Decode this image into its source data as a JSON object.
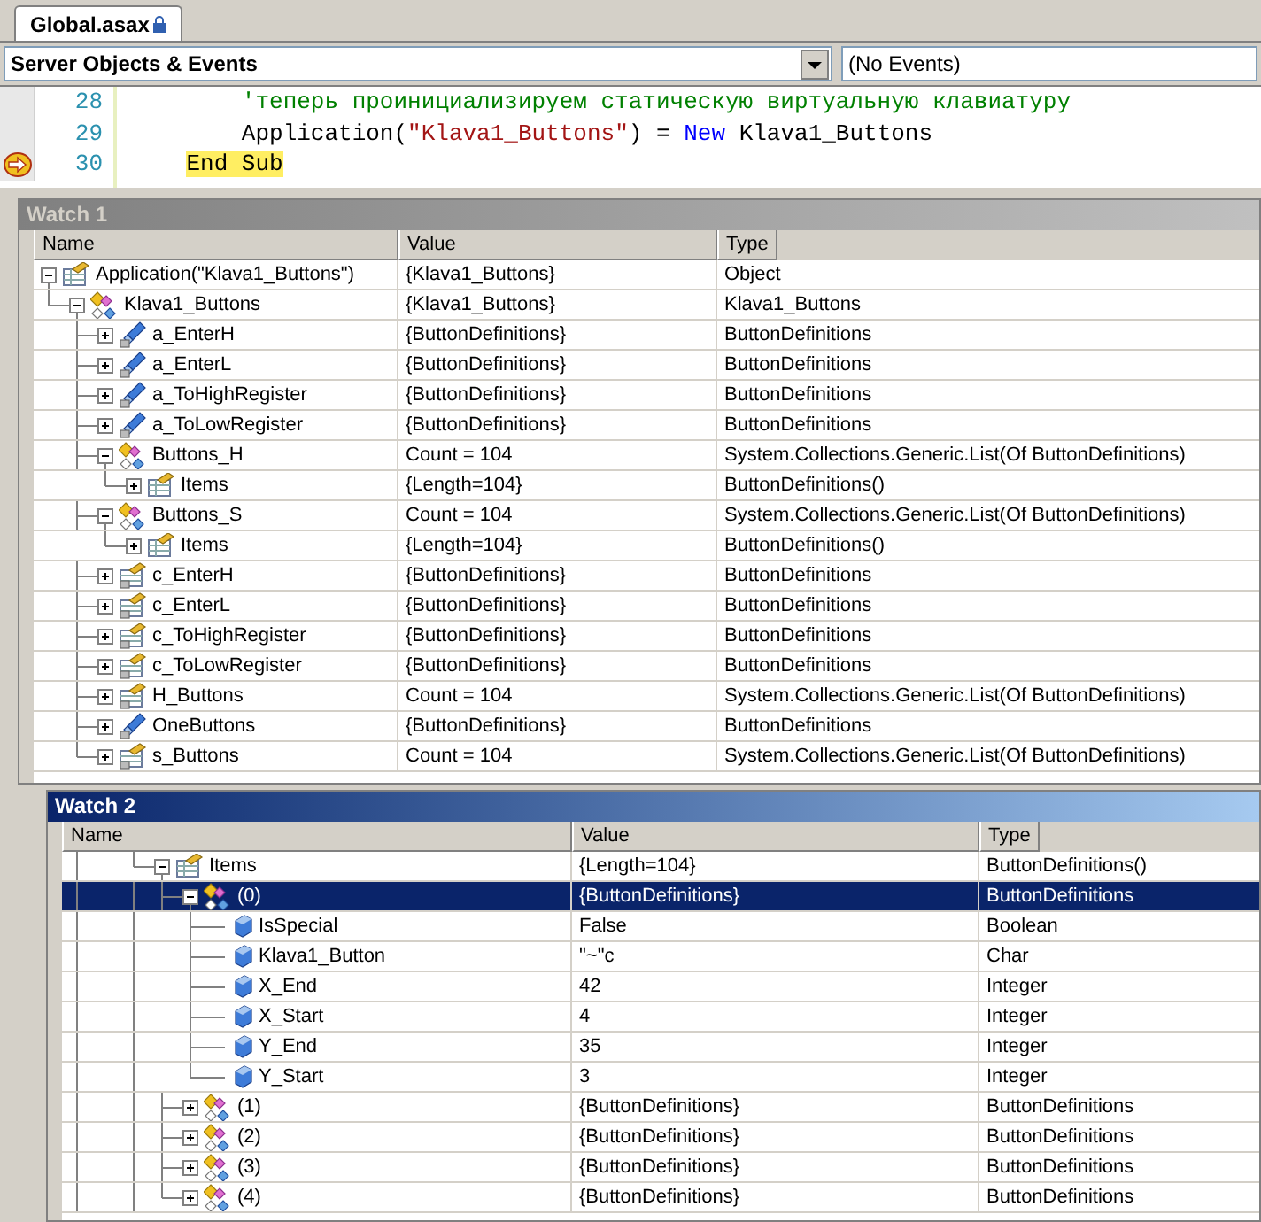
{
  "editor_tab": {
    "label": "Global.asax",
    "locked": true
  },
  "object_dropdown": {
    "value": "Server Objects & Events"
  },
  "event_dropdown": {
    "value": "(No Events)"
  },
  "code_lines": [
    {
      "number": "28",
      "current": false,
      "highlight": false,
      "parts": [
        {
          "kind": "comment",
          "text": "        'теперь проинициализируем статическую виртуальную клавиатуру"
        }
      ]
    },
    {
      "number": "29",
      "current": false,
      "highlight": false,
      "parts": [
        {
          "kind": "plain",
          "text": "        Application("
        },
        {
          "kind": "string",
          "text": "\"Klava1_Buttons\""
        },
        {
          "kind": "plain",
          "text": ") = "
        },
        {
          "kind": "keyword",
          "text": "New"
        },
        {
          "kind": "plain",
          "text": " Klava1_Buttons"
        }
      ]
    },
    {
      "number": "30",
      "current": true,
      "highlight": true,
      "parts": [
        {
          "kind": "plain",
          "text": "    End Sub"
        }
      ]
    }
  ],
  "watch_1": {
    "title": "Watch 1",
    "active": false,
    "columns": [
      "Name",
      "Value",
      "Type"
    ],
    "rows": [
      {
        "name": "Application(\"Klava1_Buttons\")",
        "value": "{Klava1_Buttons}",
        "type": "Object",
        "kind": "object",
        "expanded": true,
        "children": [
          {
            "name": "Klava1_Buttons",
            "value": "{Klava1_Buttons}",
            "type": "Klava1_Buttons",
            "kind": "class",
            "expanded": true,
            "children": [
              {
                "name": "a_EnterH",
                "value": "{ButtonDefinitions}",
                "type": "ButtonDefinitions",
                "kind": "field",
                "expanded": false
              },
              {
                "name": "a_EnterL",
                "value": "{ButtonDefinitions}",
                "type": "ButtonDefinitions",
                "kind": "field",
                "expanded": false
              },
              {
                "name": "a_ToHighRegister",
                "value": "{ButtonDefinitions}",
                "type": "ButtonDefinitions",
                "kind": "field",
                "expanded": false
              },
              {
                "name": "a_ToLowRegister",
                "value": "{ButtonDefinitions}",
                "type": "ButtonDefinitions",
                "kind": "field",
                "expanded": false
              },
              {
                "name": "Buttons_H",
                "value": "Count = 104",
                "type": "System.Collections.Generic.List(Of ButtonDefinitions)",
                "kind": "class",
                "expanded": true,
                "children": [
                  {
                    "name": "Items",
                    "value": "{Length=104}",
                    "type": "ButtonDefinitions()",
                    "kind": "object",
                    "expanded": false
                  }
                ]
              },
              {
                "name": "Buttons_S",
                "value": "Count = 104",
                "type": "System.Collections.Generic.List(Of ButtonDefinitions)",
                "kind": "class",
                "expanded": true,
                "children": [
                  {
                    "name": "Items",
                    "value": "{Length=104}",
                    "type": "ButtonDefinitions()",
                    "kind": "object",
                    "expanded": false
                  }
                ]
              },
              {
                "name": "c_EnterH",
                "value": "{ButtonDefinitions}",
                "type": "ButtonDefinitions",
                "kind": "shared",
                "expanded": false
              },
              {
                "name": "c_EnterL",
                "value": "{ButtonDefinitions}",
                "type": "ButtonDefinitions",
                "kind": "shared",
                "expanded": false
              },
              {
                "name": "c_ToHighRegister",
                "value": "{ButtonDefinitions}",
                "type": "ButtonDefinitions",
                "kind": "shared",
                "expanded": false
              },
              {
                "name": "c_ToLowRegister",
                "value": "{ButtonDefinitions}",
                "type": "ButtonDefinitions",
                "kind": "shared",
                "expanded": false
              },
              {
                "name": "H_Buttons",
                "value": "Count = 104",
                "type": "System.Collections.Generic.List(Of ButtonDefinitions)",
                "kind": "shared",
                "expanded": false
              },
              {
                "name": "OneButtons",
                "value": "{ButtonDefinitions}",
                "type": "ButtonDefinitions",
                "kind": "field",
                "expanded": false
              },
              {
                "name": "s_Buttons",
                "value": "Count = 104",
                "type": "System.Collections.Generic.List(Of ButtonDefinitions)",
                "kind": "shared",
                "expanded": false
              }
            ]
          }
        ]
      }
    ]
  },
  "watch_2": {
    "title": "Watch 2",
    "active": true,
    "columns": [
      "Name",
      "Value",
      "Type"
    ],
    "rows": [
      {
        "name": "Items",
        "value": "{Length=104}",
        "type": "ButtonDefinitions()",
        "kind": "object",
        "expanded": true,
        "selected": false,
        "children": [
          {
            "name": "(0)",
            "value": "{ButtonDefinitions}",
            "type": "ButtonDefinitions",
            "kind": "class",
            "expanded": true,
            "selected": true,
            "children": [
              {
                "name": "IsSpecial",
                "value": "False",
                "type": "Boolean",
                "kind": "member",
                "selected": false
              },
              {
                "name": "Klava1_Button",
                "value": "\"~\"c",
                "type": "Char",
                "kind": "member",
                "selected": false
              },
              {
                "name": "X_End",
                "value": "42",
                "type": "Integer",
                "kind": "member",
                "selected": false
              },
              {
                "name": "X_Start",
                "value": "4",
                "type": "Integer",
                "kind": "member",
                "selected": false
              },
              {
                "name": "Y_End",
                "value": "35",
                "type": "Integer",
                "kind": "member",
                "selected": false
              },
              {
                "name": "Y_Start",
                "value": "3",
                "type": "Integer",
                "kind": "member",
                "selected": false
              }
            ]
          },
          {
            "name": "(1)",
            "value": "{ButtonDefinitions}",
            "type": "ButtonDefinitions",
            "kind": "class",
            "expanded": false,
            "selected": false
          },
          {
            "name": "(2)",
            "value": "{ButtonDefinitions}",
            "type": "ButtonDefinitions",
            "kind": "class",
            "expanded": false,
            "selected": false
          },
          {
            "name": "(3)",
            "value": "{ButtonDefinitions}",
            "type": "ButtonDefinitions",
            "kind": "class",
            "expanded": false,
            "selected": false
          },
          {
            "name": "(4)",
            "value": "{ButtonDefinitions}",
            "type": "ButtonDefinitions",
            "kind": "class",
            "expanded": false,
            "selected": false
          }
        ]
      }
    ]
  }
}
